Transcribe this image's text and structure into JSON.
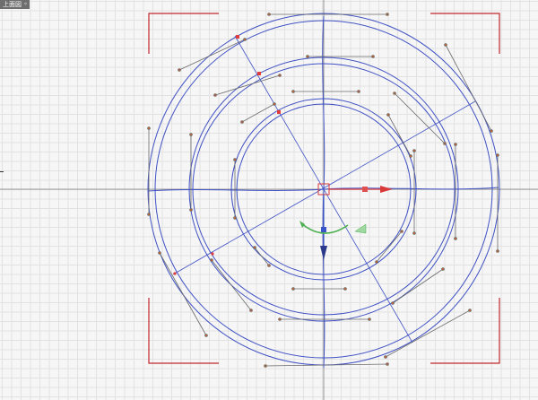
{
  "viewport": {
    "label": "上面図",
    "label_arrow": "▿",
    "colors": {
      "grid": "#e2e2e2",
      "axis": "#7a7a7a",
      "curve": "#3f51c4",
      "handle": "#8a8a8a",
      "handle_end": "#c8612a",
      "bounds": "#c0282d",
      "gizmo_x": "#d83a3a",
      "gizmo_y": "#3a55c8",
      "gizmo_rotate": "#4caf50",
      "selected_point": "#e23c3c"
    },
    "icons": [
      "viewport-menu-arrow-icon",
      "move-gizmo-icon",
      "rotate-gizmo-icon",
      "scale-gizmo-icon"
    ]
  }
}
